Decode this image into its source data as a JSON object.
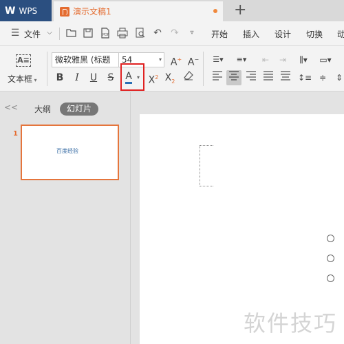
{
  "titlebar": {
    "app_label": "WPS",
    "doc_title": "演示文稿1",
    "new_tab_glyph": "+"
  },
  "menubar": {
    "file_label": "文件",
    "tabs": [
      "开始",
      "插入",
      "设计",
      "切换",
      "动"
    ]
  },
  "toolbar": {
    "textbox_label": "文本框",
    "font_name": "微软雅黑 (标题",
    "font_size": "54",
    "bold": "B",
    "italic": "I",
    "underline": "U",
    "strike": "S",
    "font_color": "A",
    "font_color_underline": "#2b6fb5",
    "superscript": "X",
    "subscript": "X",
    "grow_font": "A",
    "shrink_font": "A"
  },
  "leftpanel": {
    "tabs": {
      "outline": "大纲",
      "slides": "幻灯片"
    },
    "slides": [
      {
        "number": "1",
        "text": "百度经验"
      }
    ]
  },
  "watermark": "软件技巧",
  "colors": {
    "accent": "#e46c30",
    "wps_blue": "#2b4f80",
    "highlight_red": "#e02020"
  }
}
